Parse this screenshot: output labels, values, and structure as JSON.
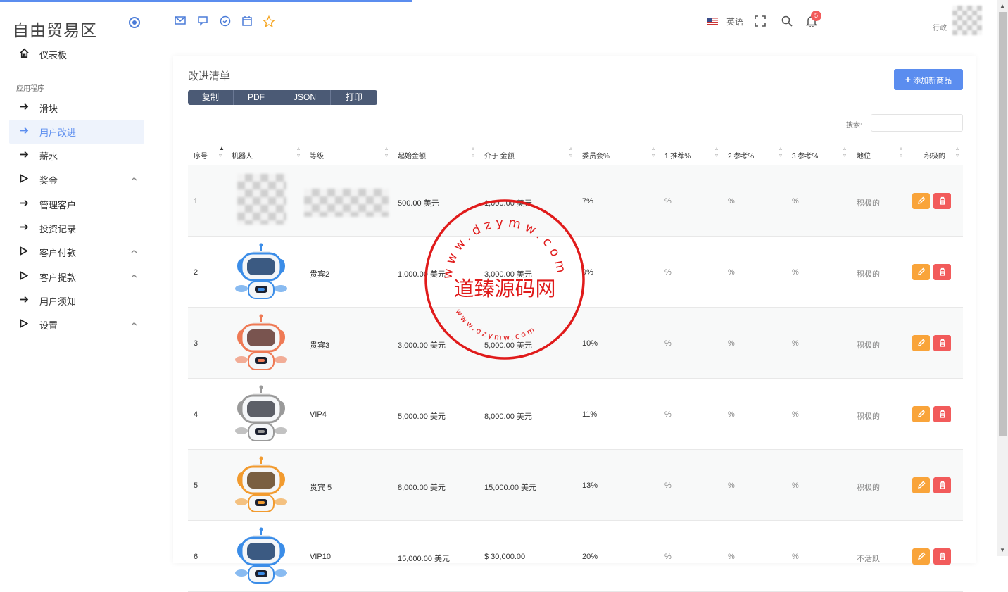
{
  "sidebar": {
    "brand": "自由贸易区",
    "dashboard": "仪表板",
    "section": "应用程序",
    "items": [
      {
        "label": "滑块",
        "icon": "arrow-right-icon",
        "active": false,
        "expandable": false
      },
      {
        "label": "用户改进",
        "icon": "arrow-right-icon",
        "active": true,
        "expandable": false
      },
      {
        "label": "薪水",
        "icon": "arrow-right-icon",
        "active": false,
        "expandable": false
      },
      {
        "label": "奖金",
        "icon": "play-icon",
        "active": false,
        "expandable": true
      },
      {
        "label": "管理客户",
        "icon": "arrow-right-icon",
        "active": false,
        "expandable": false
      },
      {
        "label": "投资记录",
        "icon": "arrow-right-icon",
        "active": false,
        "expandable": false
      },
      {
        "label": "客户付款",
        "icon": "play-icon",
        "active": false,
        "expandable": true
      },
      {
        "label": "客户提款",
        "icon": "play-icon",
        "active": false,
        "expandable": true
      },
      {
        "label": "用户须知",
        "icon": "arrow-right-icon",
        "active": false,
        "expandable": false
      },
      {
        "label": "设置",
        "icon": "play-icon",
        "active": false,
        "expandable": true
      }
    ]
  },
  "topbar": {
    "language": "英语",
    "notification_count": "5",
    "user_name": "行政"
  },
  "card": {
    "title": "改进清单",
    "export_buttons": [
      "复制",
      "PDF",
      "JSON",
      "打印"
    ],
    "add_button": "添加新商品",
    "search_label": "搜索:"
  },
  "table": {
    "headers": [
      "序号",
      "机器人",
      "等级",
      "起始金额",
      "介于 金额",
      "委员会%",
      "1 推荐%",
      "2 参考%",
      "3 参考%",
      "地位",
      "积极的"
    ],
    "rows": [
      {
        "index": "1",
        "level": "",
        "start": "500.00 美元",
        "between": "1,000.00 美元",
        "commission": "7%",
        "ref1": "%",
        "ref2": "%",
        "ref3": "%",
        "status": "积极的",
        "robot": "blurred"
      },
      {
        "index": "2",
        "level": "贵宾2",
        "start": "1,000.00 美元",
        "between": "3,000.00 美元",
        "commission": "9%",
        "ref1": "%",
        "ref2": "%",
        "ref3": "%",
        "status": "积极的",
        "robot": "#3b8de8"
      },
      {
        "index": "3",
        "level": "贵宾3",
        "start": "3,000.00 美元",
        "between": "5,000.00 美元",
        "commission": "10%",
        "ref1": "%",
        "ref2": "%",
        "ref3": "%",
        "status": "积极的",
        "robot": "#ef7a55"
      },
      {
        "index": "4",
        "level": "VIP4",
        "start": "5,000.00 美元",
        "between": "8,000.00 美元",
        "commission": "11%",
        "ref1": "%",
        "ref2": "%",
        "ref3": "%",
        "status": "积极的",
        "robot": "#9a9a9a"
      },
      {
        "index": "5",
        "level": "贵宾 5",
        "start": "8,000.00 美元",
        "between": "15,000.00 美元",
        "commission": "13%",
        "ref1": "%",
        "ref2": "%",
        "ref3": "%",
        "status": "积极的",
        "robot": "#f29b2f"
      },
      {
        "index": "6",
        "level": "VIP10",
        "start": "15,000.00 美元",
        "between": "$ 30,000.00",
        "commission": "20%",
        "ref1": "%",
        "ref2": "%",
        "ref3": "%",
        "status": "不活跃",
        "robot": "#3b8de8"
      }
    ]
  },
  "watermark": {
    "main": "道臻源码网",
    "top": "www.dzymw.com",
    "bottom": "www.dzymw.com",
    "color": "#e01b1b"
  },
  "colors": {
    "accent": "#5b8def",
    "edit": "#f9a43a",
    "delete": "#f25b5b",
    "export": "#4b5a75"
  }
}
